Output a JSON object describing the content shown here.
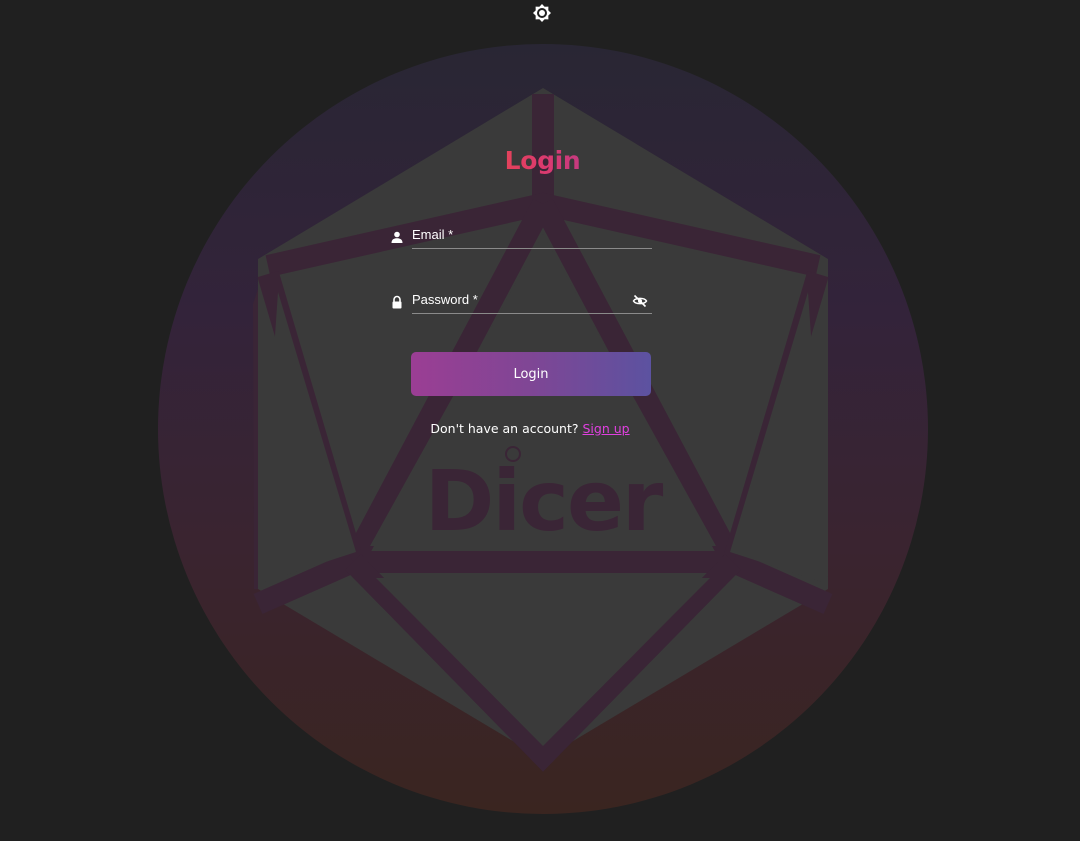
{
  "page": {
    "title": "Login",
    "brand": "Dicer"
  },
  "theme_toggle": {
    "icon": "brightness-icon"
  },
  "form": {
    "email": {
      "label": "Email *",
      "value": "",
      "icon": "person-icon"
    },
    "password": {
      "label": "Password *",
      "value": "",
      "icon": "lock-icon",
      "toggle_icon": "eye-off-icon"
    },
    "submit_label": "Login"
  },
  "signup": {
    "prompt": "Don't have an account?",
    "link_label": "Sign up"
  },
  "colors": {
    "background": "#202020",
    "title_gradient_start": "#f0503a",
    "title_gradient_end": "#a0399e",
    "button_gradient_start": "#9b3e94",
    "button_gradient_end": "#5c52a0",
    "link": "#e040e0",
    "circle_top": "#292634",
    "circle_bottom": "#3a2320",
    "die_fill": "#3a3a3a",
    "die_lines": "#3a2536"
  }
}
